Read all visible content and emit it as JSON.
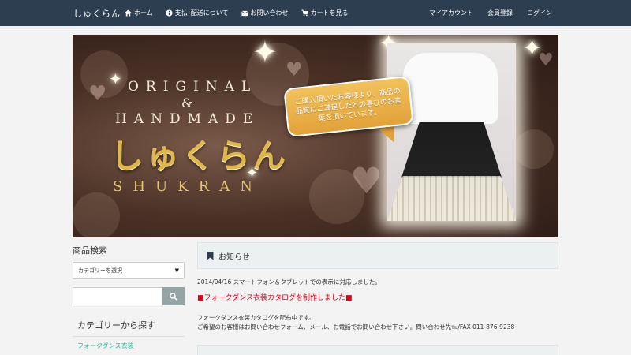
{
  "navbar": {
    "brand": "しゅくらん",
    "left_items": [
      {
        "icon": "home-icon",
        "label": "ホーム"
      },
      {
        "icon": "info-icon",
        "label": "支払･配送について"
      },
      {
        "icon": "mail-icon",
        "label": "お問い合わせ"
      },
      {
        "icon": "cart-icon",
        "label": "カートを見る"
      }
    ],
    "right_items": [
      {
        "label": "マイアカウント"
      },
      {
        "label": "会員登録"
      },
      {
        "label": "ログイン"
      }
    ]
  },
  "banner": {
    "line1": "ORIGINAL",
    "amp": "&",
    "line2": "HANDMADE",
    "name_jp": "しゅくらん",
    "name_en": "SHUKRAN",
    "bubble": "ご購入頂いたお客様より、商品の品質にご満足したとの喜びのお言葉を頂いています。"
  },
  "sidebar": {
    "search_title": "商品検索",
    "category_select": "カテゴリーを選択",
    "category_title": "カテゴリーから探す",
    "categories": [
      "フォークダンス衣装"
    ]
  },
  "main": {
    "notice_title": "お知らせ",
    "news_line1": "2014/04/16 スマートフォン＆タブレットでの表示に対応しました。",
    "news_highlight": "■フォークダンス衣装カタログを制作しました■",
    "news_line2": "フォークダンス衣装カタログを配布中です。",
    "news_line3": "ご希望のお客様はお問い合わせフォーム、メール、お電話でお問い合わせ下さい。問い合わせ先℡/FAX 011-876-9238"
  },
  "colors": {
    "navbar": "#2c3e50",
    "link": "#18bc9c",
    "highlight": "#e0001a",
    "panel": "#ecf0f1"
  }
}
